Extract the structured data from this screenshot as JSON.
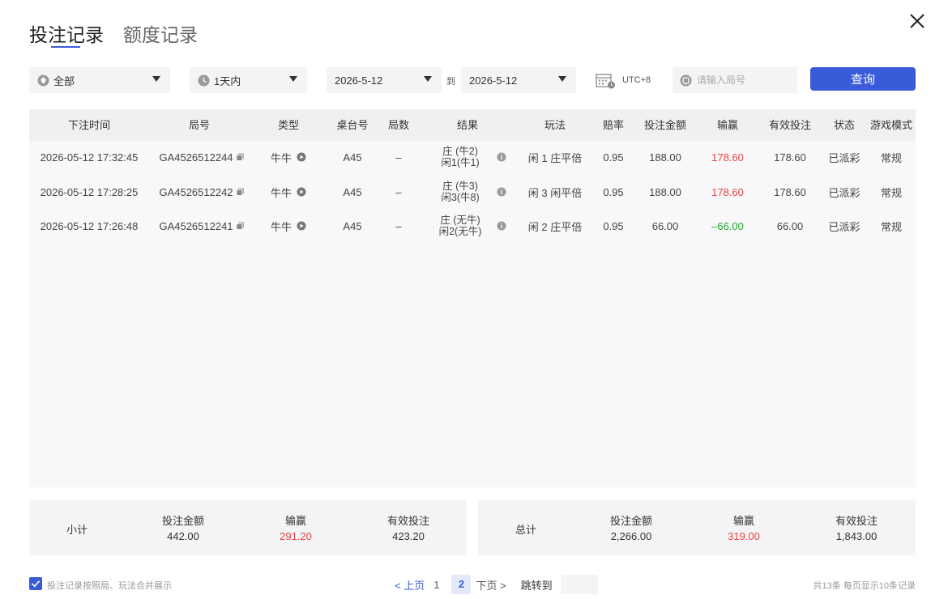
{
  "tabs": [
    "投注记录",
    "额度记录"
  ],
  "filters": {
    "game_type": "全部",
    "time_range": "1天内",
    "date_from": "2026-5-12",
    "to_label": "到",
    "date_to": "2026-5-12",
    "timezone": "UTC+8",
    "search_placeholder": "请输入局号",
    "query_label": "查询"
  },
  "table": {
    "headers": [
      "下注时间",
      "局号",
      "类型",
      "桌台号",
      "局数",
      "结果",
      "玩法",
      "赔率",
      "投注金额",
      "输赢",
      "有效投注",
      "状态",
      "游戏模式"
    ],
    "rows": [
      {
        "time": "2026-05-12 17:32:45",
        "round": "GA4526512244",
        "type": "牛牛",
        "table": "A45",
        "count": "–",
        "result_1": "庄 (牛2)",
        "result_2": "闲1(牛1)",
        "play": "闲 1 庄平倍",
        "odds": "0.95",
        "bet": "188.00",
        "win": "178.60",
        "win_sign": "positive",
        "valid": "178.60",
        "status": "已派彩",
        "mode": "常规"
      },
      {
        "time": "2026-05-12 17:28:25",
        "round": "GA4526512242",
        "type": "牛牛",
        "table": "A45",
        "count": "–",
        "result_1": "庄 (牛3)",
        "result_2": "闲3(牛8)",
        "play": "闲 3 闲平倍",
        "odds": "0.95",
        "bet": "188.00",
        "win": "178.60",
        "win_sign": "positive",
        "valid": "178.60",
        "status": "已派彩",
        "mode": "常规"
      },
      {
        "time": "2026-05-12 17:26:48",
        "round": "GA4526512241",
        "type": "牛牛",
        "table": "A45",
        "count": "–",
        "result_1": "庄 (无牛)",
        "result_2": "闲2(无牛)",
        "play": "闲 2 庄平倍",
        "odds": "0.95",
        "bet": "66.00",
        "win": "–66.00",
        "win_sign": "negative",
        "valid": "66.00",
        "status": "已派彩",
        "mode": "常规"
      }
    ]
  },
  "subtotal": {
    "label": "小计",
    "bet_label": "投注金额",
    "bet": "442.00",
    "win_label": "输赢",
    "win": "291.20",
    "valid_label": "有效投注",
    "valid": "423.20"
  },
  "total": {
    "label": "总计",
    "bet_label": "投注金额",
    "bet": "2,266.00",
    "win_label": "输赢",
    "win": "319.00",
    "valid_label": "有效投注",
    "valid": "1,843.00"
  },
  "footer": {
    "merge_label": "投注记录按照局、玩法合并展示",
    "prev": "< 上页",
    "pages": [
      "1",
      "2"
    ],
    "current_page": "2",
    "next": "下页 >",
    "jump_label": "跳转到",
    "total_info": "共13条  每页显示10条记录"
  },
  "colors": {
    "accent": "#3a5bd9",
    "win": "#e64545",
    "loss": "#1fa82e"
  }
}
